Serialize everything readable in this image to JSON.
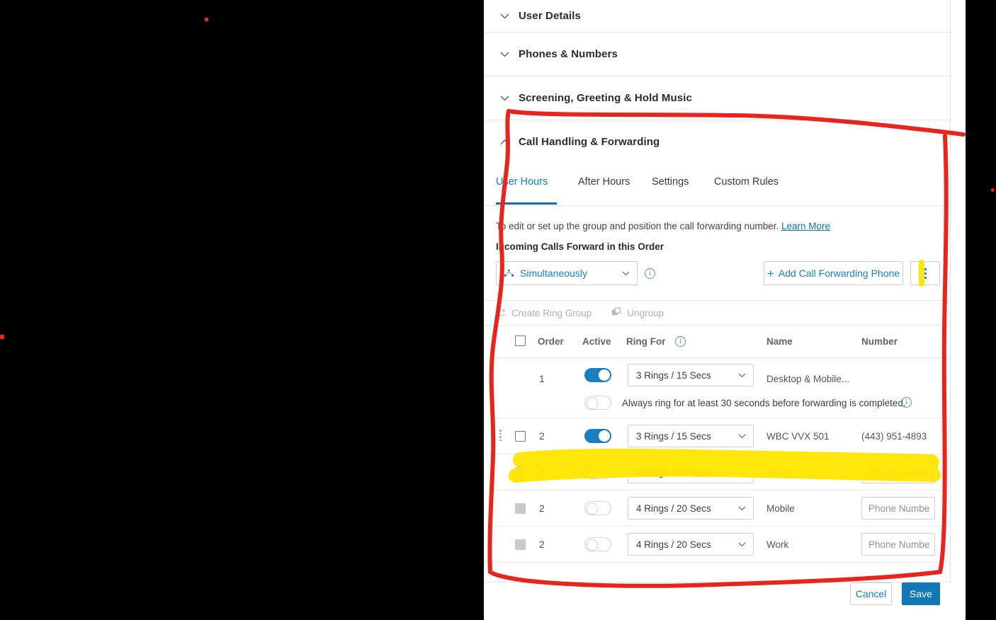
{
  "sections": [
    {
      "label": "User Details",
      "expanded": false
    },
    {
      "label": "Phones & Numbers",
      "expanded": false
    },
    {
      "label": "Screening, Greeting & Hold Music",
      "expanded": false
    },
    {
      "label": "Call Handling & Forwarding",
      "expanded": true
    }
  ],
  "tabs": [
    {
      "label": "User Hours",
      "active": true
    },
    {
      "label": "After Hours",
      "active": false
    },
    {
      "label": "Settings",
      "active": false
    },
    {
      "label": "Custom Rules",
      "active": false
    }
  ],
  "help": {
    "text": "To edit or set up the group and position the call forwarding number.",
    "link": "Learn More"
  },
  "order_title": "Incoming Calls Forward in this Order",
  "mode_select": {
    "value": "Simultaneously",
    "icon": "fork-network-icon",
    "info_tooltip": "info-icon"
  },
  "add_phone_button": "Add Call Forwarding Phone",
  "kebab_menu": "more-options-icon",
  "group_toolbar": [
    {
      "label": "Create Ring Group",
      "icon": "user-group-icon",
      "disabled": true
    },
    {
      "label": "Ungroup",
      "icon": "ungroup-icon",
      "disabled": true
    }
  ],
  "table": {
    "headers": [
      "Order",
      "Active",
      "Ring For",
      "Name",
      "Number"
    ],
    "header_select_all": "select-all-checkbox",
    "ring_for_info": "info-icon",
    "rows": [
      {
        "order": "1",
        "active": true,
        "ring_for": "3 Rings / 15 Secs",
        "name": "Desktop & Mobile...",
        "number": "",
        "checkbox": "none",
        "drag": false,
        "number_is_input": false
      },
      {
        "order": "2",
        "active": true,
        "ring_for": "3 Rings / 15 Secs",
        "name": "WBC VVX 501",
        "number": "(443) 951-4893",
        "checkbox": "enabled",
        "drag": true,
        "number_is_input": false
      },
      {
        "order": "2",
        "active": false,
        "ring_for": "4 Rings / 20 Secs",
        "name": "Home",
        "number": "Phone Numbe",
        "checkbox": "disabled",
        "drag": false,
        "number_is_input": true
      },
      {
        "order": "2",
        "active": false,
        "ring_for": "4 Rings / 20 Secs",
        "name": "Mobile",
        "number": "Phone Numbe",
        "checkbox": "disabled",
        "drag": false,
        "number_is_input": true
      },
      {
        "order": "2",
        "active": false,
        "ring_for": "4 Rings / 20 Secs",
        "name": "Work",
        "number": "Phone Numbe",
        "checkbox": "disabled",
        "drag": false,
        "number_is_input": true
      }
    ],
    "always_ring": {
      "enabled": false,
      "label": "Always ring for at least 30 seconds before forwarding is completed.",
      "info": "info-icon"
    }
  },
  "footer": {
    "cancel": "Cancel",
    "save": "Save"
  },
  "colors": {
    "accent_blue": "#1a7fc0",
    "save_blue": "#1178b8",
    "annotation_red": "#e8241c",
    "highlight_yellow": "#ffe600",
    "backdrop": "#000000"
  }
}
